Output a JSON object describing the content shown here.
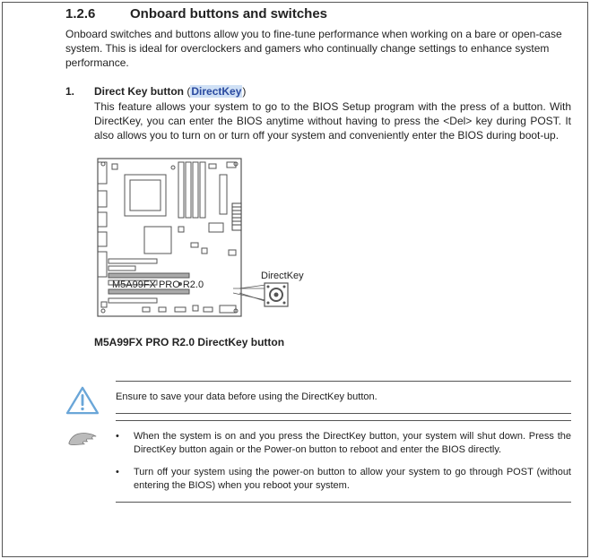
{
  "heading": {
    "number": "1.2.6",
    "title": "Onboard buttons and switches"
  },
  "intro": "Onboard switches and buttons allow you to fine-tune performance when working on a bare or open-case system. This is ideal for overclockers and gamers who continually change settings to enhance system performance.",
  "item": {
    "number": "1.",
    "title": "Direct Key button",
    "tag_open": " (",
    "tag": "DirectKey",
    "tag_close": ")",
    "desc": "This feature allows your system to go to the BIOS Setup program with the press of a button. With DirectKey, you can enter the BIOS anytime without having to press the <Del> key during POST. It also allows you to turn on or turn off your system and conveniently enter the BIOS during boot-up."
  },
  "figure": {
    "directkey_label": "DirectKey",
    "board_text": "M5A99FX PRO R2.0",
    "caption": "M5A99FX PRO R2.0 DirectKey button"
  },
  "warning": {
    "text": "Ensure to save your data before using the DirectKey button."
  },
  "notes": {
    "items": [
      "When the system is on and you press the DirectKey button, your system will shut down. Press the DirectKey button again or the Power-on button to reboot and enter the BIOS directly.",
      "Turn off your system using the power-on button to allow your system to go through POST (without entering the BIOS) when you reboot your system."
    ]
  }
}
